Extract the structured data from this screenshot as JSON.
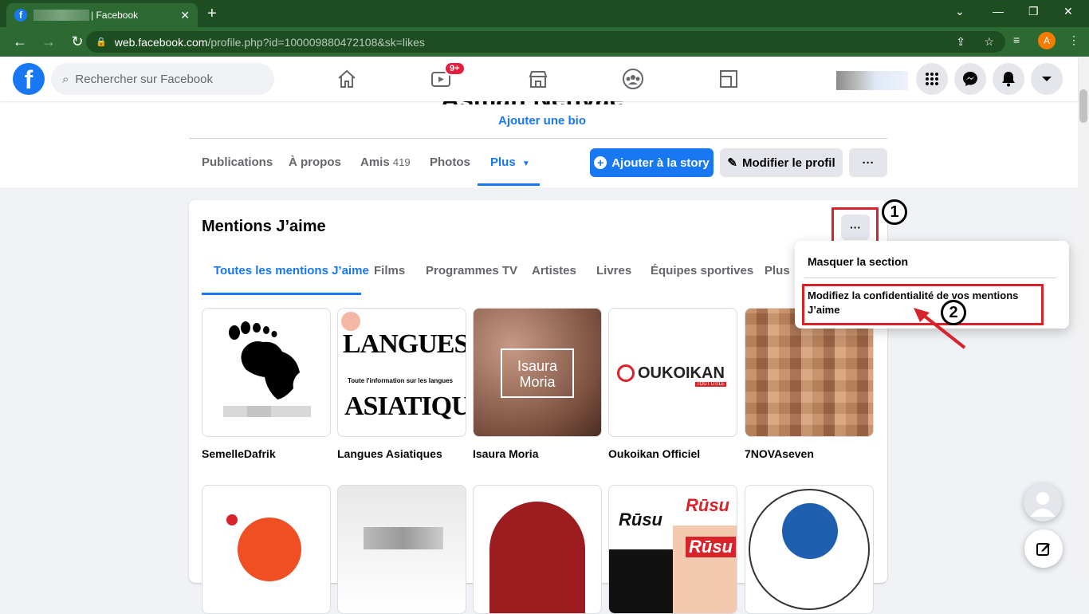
{
  "browser": {
    "tab_title": "| Facebook",
    "url_domain": "web.facebook.com",
    "url_path": "/profile.php?id=100009880472108&sk=likes",
    "profile_initial": "A"
  },
  "header": {
    "search_placeholder": "Rechercher sur Facebook",
    "watch_badge": "9+"
  },
  "profile": {
    "name": "Asman Nenvae",
    "add_bio": "Ajouter une bio",
    "tabs": [
      {
        "label": "Publications"
      },
      {
        "label": "À propos"
      },
      {
        "label": "Amis",
        "count": "419"
      },
      {
        "label": "Photos"
      },
      {
        "label": "Plus"
      }
    ],
    "add_story": "Ajouter à la story",
    "edit_profile": "Modifier le profil"
  },
  "likes": {
    "title": "Mentions J’aime",
    "tabs": [
      "Toutes les mentions J’aime",
      "Films",
      "Programmes TV",
      "Artistes",
      "Livres",
      "Équipes sportives",
      "Plus"
    ],
    "items": [
      {
        "name": "SemelleDafrik"
      },
      {
        "name": "Langues Asiatiques",
        "logo_top": "LANGUES",
        "logo_sub": "Toute l'information sur les langues",
        "logo_bottom": "ASIATIQUES"
      },
      {
        "name": "Isaura Moria",
        "logo": "Isaura Moria"
      },
      {
        "name": "Oukoikan Officiel",
        "logo": "OUKOIKAN",
        "logo_sub": "TOUT UTILE"
      },
      {
        "name": "7NOVAseven"
      }
    ],
    "row2_labels": {
      "rusu": "Rūsu"
    }
  },
  "menu": {
    "hide_section": "Masquer la section",
    "edit_privacy": "Modifiez la confidentialité de vos mentions J’aime"
  },
  "annotations": {
    "step1": "1",
    "step2": "2"
  },
  "colors": {
    "brand": "#1877f2",
    "chrome": "#2d6a33",
    "annotation": "#d9232a"
  }
}
